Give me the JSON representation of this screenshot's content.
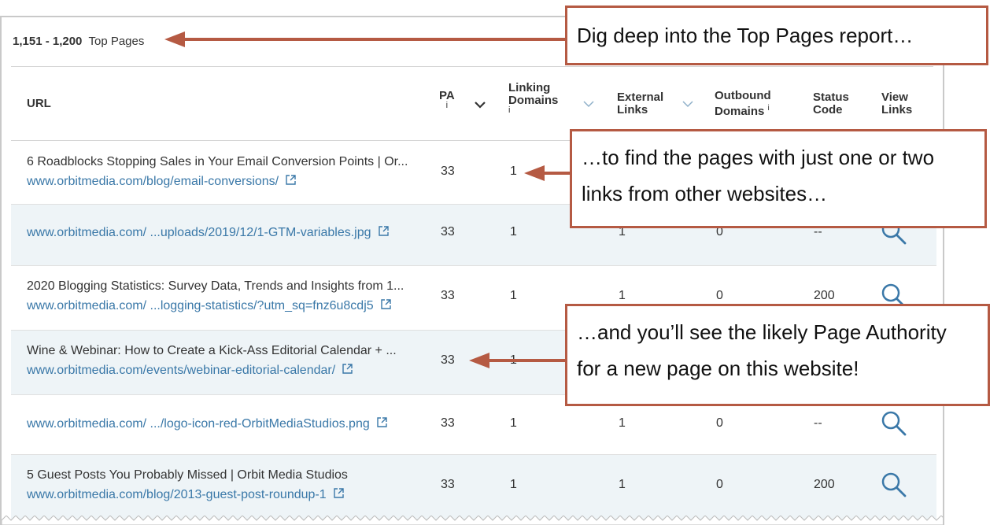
{
  "header": {
    "range_count": "1,151 - 1,200",
    "range_label": "Top Pages"
  },
  "columns": {
    "url": "URL",
    "pa": "PA",
    "linking_domains": [
      "Linking",
      "Domains"
    ],
    "external_links": [
      "External",
      "Links"
    ],
    "outbound_domains": [
      "Outbound",
      "Domains"
    ],
    "status_code": [
      "Status",
      "Code"
    ],
    "view_links": [
      "View",
      "Links"
    ],
    "info_glyph": "i"
  },
  "rows": [
    {
      "title": "6 Roadblocks Stopping Sales in Your Email Conversion Points | Or...",
      "url": "www.orbitmedia.com/blog/email-conversions/",
      "pa": "33",
      "ld": "1",
      "el": "",
      "od": "",
      "sc": ""
    },
    {
      "title": "",
      "url": "www.orbitmedia.com/  ...uploads/2019/12/1-GTM-variables.jpg",
      "pa": "33",
      "ld": "1",
      "el": "1",
      "od": "0",
      "sc": "--"
    },
    {
      "title": "2020 Blogging Statistics: Survey Data, Trends and Insights from 1...",
      "url": "www.orbitmedia.com/  ...logging-statistics/?utm_sq=fnz6u8cdj5",
      "pa": "33",
      "ld": "1",
      "el": "1",
      "od": "0",
      "sc": "200"
    },
    {
      "title": "Wine & Webinar: How to Create a Kick-Ass Editorial Calendar + ...",
      "url": "www.orbitmedia.com/events/webinar-editorial-calendar/",
      "pa": "33",
      "ld": "1",
      "el": "",
      "od": "",
      "sc": ""
    },
    {
      "title": "",
      "url": "www.orbitmedia.com/  .../logo-icon-red-OrbitMediaStudios.png",
      "pa": "33",
      "ld": "1",
      "el": "1",
      "od": "0",
      "sc": "--"
    },
    {
      "title": "5 Guest Posts You Probably Missed | Orbit Media Studios",
      "url": "www.orbitmedia.com/blog/2013-guest-post-roundup-1",
      "pa": "33",
      "ld": "1",
      "el": "1",
      "od": "0",
      "sc": "200"
    }
  ],
  "callouts": {
    "top": "Dig deep into the Top Pages report…",
    "middle": [
      "…to find the pages with just one or two",
      "links from other websites…"
    ],
    "bottom": [
      "…and you’ll see the likely Page Authority",
      "for a new page on this website!"
    ]
  },
  "colors": {
    "accent": "#b55a43",
    "link": "#3a78a8",
    "row_alt": "#eef4f7"
  }
}
